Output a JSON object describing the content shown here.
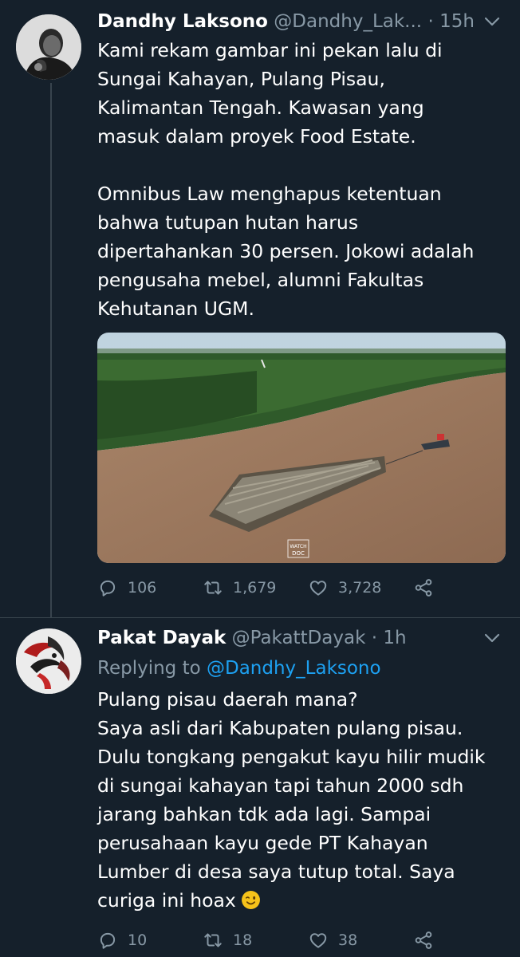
{
  "tweets": [
    {
      "name": "Dandhy Laksono",
      "handle": "@Dandhy_Lak...",
      "separator": "·",
      "time": "15h",
      "paragraph1": [
        "Kami rekam gambar ini pekan lalu di",
        "Sungai Kahayan, Pulang Pisau,",
        "Kalimantan Tengah. Kawasan yang",
        "masuk dalam proyek Food Estate."
      ],
      "paragraph2": [
        "Omnibus Law menghapus ketentuan",
        "bahwa tutupan hutan harus",
        "dipertahankan 30 persen. Jokowi adalah",
        "pengusaha mebel, alumni Fakultas",
        "Kehutanan UGM."
      ],
      "media_watermark": [
        "WATCH",
        "DOC"
      ],
      "counts": {
        "replies": "106",
        "retweets": "1,679",
        "likes": "3,728"
      }
    },
    {
      "name": "Pakat Dayak",
      "handle": "@PakattDayak",
      "separator": "·",
      "time": "1h",
      "replying_prefix": "Replying to",
      "replying_to": "@Dandhy_Laksono",
      "lines": [
        "Pulang pisau daerah mana?",
        "Saya asli dari Kabupaten pulang pisau.",
        "Dulu tongkang pengakut kayu hilir mudik",
        "di sungai kahayan tapi tahun 2000 sdh",
        "jarang bahkan tdk ada lagi. Sampai",
        "perusahaan kayu gede PT Kahayan",
        "Lumber di desa saya tutup total. Saya",
        "curiga ini hoax"
      ],
      "emoji": "winking-face",
      "counts": {
        "replies": "10",
        "retweets": "18",
        "likes": "38"
      }
    }
  ],
  "colors": {
    "background": "#15202b",
    "text": "#ffffff",
    "secondary": "#8899a6",
    "link": "#1da1f2",
    "divider": "#38444d"
  },
  "icons": {
    "reply": "speech-bubble-icon",
    "retweet": "retweet-arrows-icon",
    "like": "heart-outline-icon",
    "share": "share-nodes-icon",
    "more": "chevron-down-icon"
  }
}
